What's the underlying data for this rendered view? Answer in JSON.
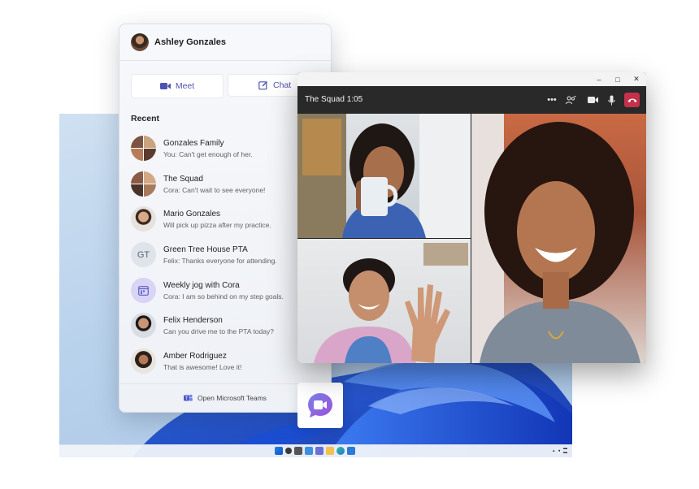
{
  "chat_panel": {
    "user_name": "Ashley Gonzales",
    "meet_label": "Meet",
    "chat_label": "Chat",
    "recent_label": "Recent",
    "footer_label": "Open Microsoft Teams",
    "conversations": [
      {
        "name": "Gonzales Family",
        "preview": "You: Can't get enough of her.",
        "avatar": "group-photo"
      },
      {
        "name": "The Squad",
        "preview": "Cora: Can't wait to see everyone!",
        "avatar": "group-photo"
      },
      {
        "name": "Mario Gonzales",
        "preview": "Will pick up pizza after my practice.",
        "avatar": "person-photo"
      },
      {
        "name": "Green Tree House PTA",
        "preview": "Felix: Thanks everyone for attending.",
        "avatar": "initials",
        "initials": "GT"
      },
      {
        "name": "Weekly jog with Cora",
        "preview": "Cora: I am so behind on my step goals.",
        "avatar": "calendar-icon"
      },
      {
        "name": "Felix Henderson",
        "preview": "Can you drive me to the PTA today?",
        "avatar": "person-photo"
      },
      {
        "name": "Amber Rodriguez",
        "preview": "That is awesome! Love it!",
        "avatar": "person-photo"
      }
    ]
  },
  "call_window": {
    "title": "The Squad 1:05",
    "controls": [
      "more-icon",
      "participants-icon",
      "camera-icon",
      "microphone-icon",
      "hang-up-icon"
    ],
    "window_controls": [
      "minimize-icon",
      "maximize-icon",
      "close-icon"
    ],
    "participants": [
      "participant-drinking",
      "participant-waving",
      "participant-laughing"
    ]
  },
  "colors": {
    "accent": "#4f52b2",
    "hangup": "#c4314b",
    "call_bar": "#292929"
  }
}
